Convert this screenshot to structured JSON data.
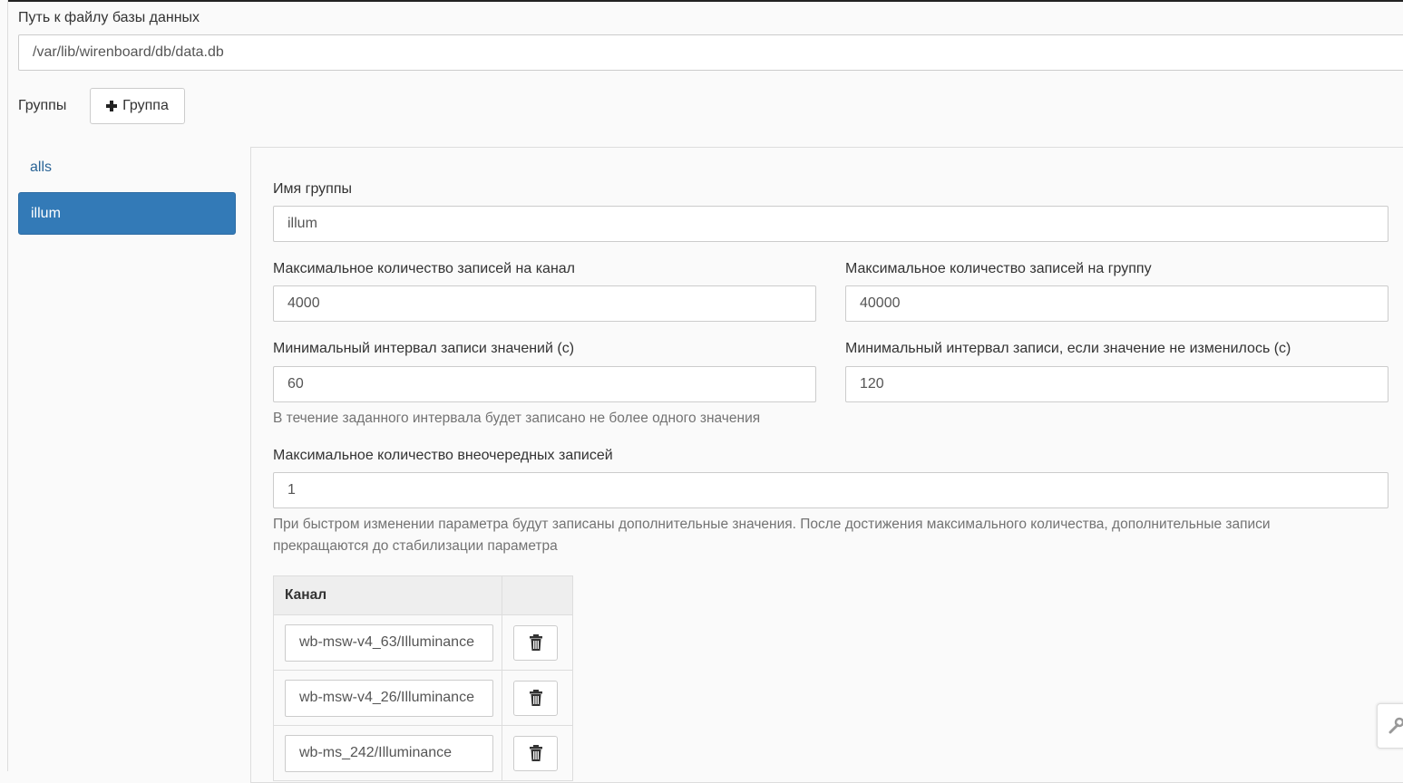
{
  "db_path": {
    "label": "Путь к файлу базы данных",
    "value": "/var/lib/wirenboard/db/data.db"
  },
  "groups": {
    "label": "Группы",
    "add_button_label": "Группа",
    "items": [
      {
        "name": "alls",
        "active": false
      },
      {
        "name": "illum",
        "active": true
      }
    ]
  },
  "group_form": {
    "name_label": "Имя группы",
    "name_value": "illum",
    "max_records_channel_label": "Максимальное количество записей на канал",
    "max_records_channel_value": "4000",
    "max_records_group_label": "Максимальное количество записей на группу",
    "max_records_group_value": "40000",
    "min_interval_label": "Минимальный интервал записи значений (с)",
    "min_interval_value": "60",
    "min_interval_unchanged_label": "Минимальный интервал записи, если значение не изменилось (с)",
    "min_interval_unchanged_value": "120",
    "min_interval_help": "В течение заданного интервала будет записано не более одного значения",
    "max_unchanged_label": "Максимальное количество внеочередных записей",
    "max_unchanged_value": "1",
    "max_unchanged_help_line1": "При быстром изменении параметра будут записаны дополнительные значения. После достижения максимального количества, дополнительные записи",
    "max_unchanged_help_line2": "прекращаются до стабилизации параметра"
  },
  "channels_table": {
    "header_channel": "Канал",
    "rows": [
      {
        "value": "wb-msw-v4_63/Illuminance"
      },
      {
        "value": "wb-msw-v4_26/Illuminance"
      },
      {
        "value": "wb-ms_242/Illuminance"
      }
    ]
  },
  "icons": {
    "add": "plus-icon",
    "delete": "trash-icon",
    "tool": "wrench-icon"
  },
  "colors": {
    "active_group_bg": "#337ab7",
    "link": "#2a6496",
    "help_text": "#737373"
  }
}
